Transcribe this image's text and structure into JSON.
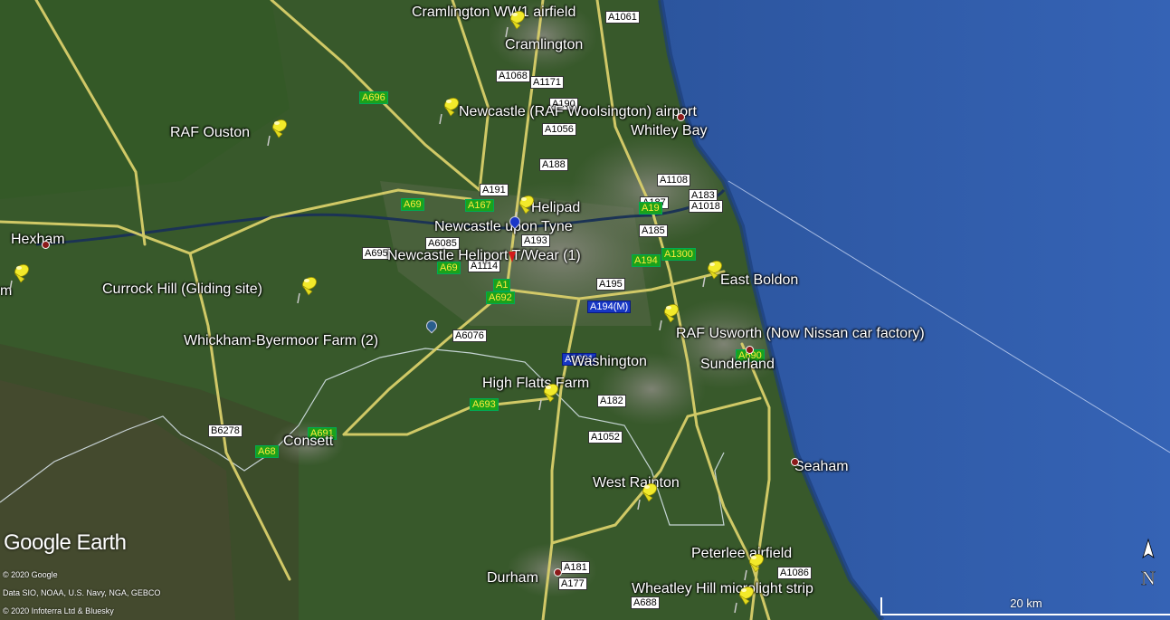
{
  "places": [
    {
      "name": "Cramlington WW1 airfield"
    },
    {
      "name": "Cramlington"
    },
    {
      "name": "Newcastle (RAF Woolsington) airport"
    },
    {
      "name": "Whitley Bay"
    },
    {
      "name": "RAF Ouston"
    },
    {
      "name": "Helipad"
    },
    {
      "name": "Newcastle upon Tyne"
    },
    {
      "name": "Newcastle Heliport T/Wear (1)"
    },
    {
      "name": "Hexham"
    },
    {
      "name": "Currock Hill (Gliding site)"
    },
    {
      "name": "East Boldon"
    },
    {
      "name": "Whickham-Byermoor Farm (2)"
    },
    {
      "name": "RAF Usworth  (Now Nissan car factory)"
    },
    {
      "name": "Sunderland"
    },
    {
      "name": "Washington"
    },
    {
      "name": "High Flatts Farm"
    },
    {
      "name": "Consett"
    },
    {
      "name": "Seaham"
    },
    {
      "name": "West Rainton"
    },
    {
      "name": "Peterlee airfield"
    },
    {
      "name": "Durham"
    },
    {
      "name": "Wheatley Hill microlight strip"
    },
    {
      "name": "m"
    }
  ],
  "roads": [
    "A1061",
    "A1068",
    "A1171",
    "A190",
    "A696",
    "A1056",
    "A188",
    "A191",
    "A69",
    "A167",
    "A1108",
    "A187",
    "A183",
    "A1018",
    "A6085",
    "A695",
    "A193",
    "A185",
    "A19",
    "A1300",
    "A69",
    "A1114",
    "A194",
    "A1",
    "A692",
    "A195",
    "A194(M)",
    "A690",
    "A6076",
    "A1231",
    "A693",
    "A182",
    "B6278",
    "A691",
    "A68",
    "A1052",
    "A181",
    "A177",
    "A688",
    "A1086"
  ],
  "brand": "Google Earth",
  "credits": [
    "© 2020 Google",
    "Data SIO, NOAA, U.S. Navy, NGA, GEBCO",
    "© 2020 Infoterra Ltd & Bluesky"
  ],
  "scale_label": "20 km",
  "north_label": "N",
  "colors": {
    "sea": "#2f5aa8",
    "land": "#3c5e2c",
    "road": "#d9cf6a",
    "pin": "#f2ea2a",
    "label": "#ffffff"
  }
}
